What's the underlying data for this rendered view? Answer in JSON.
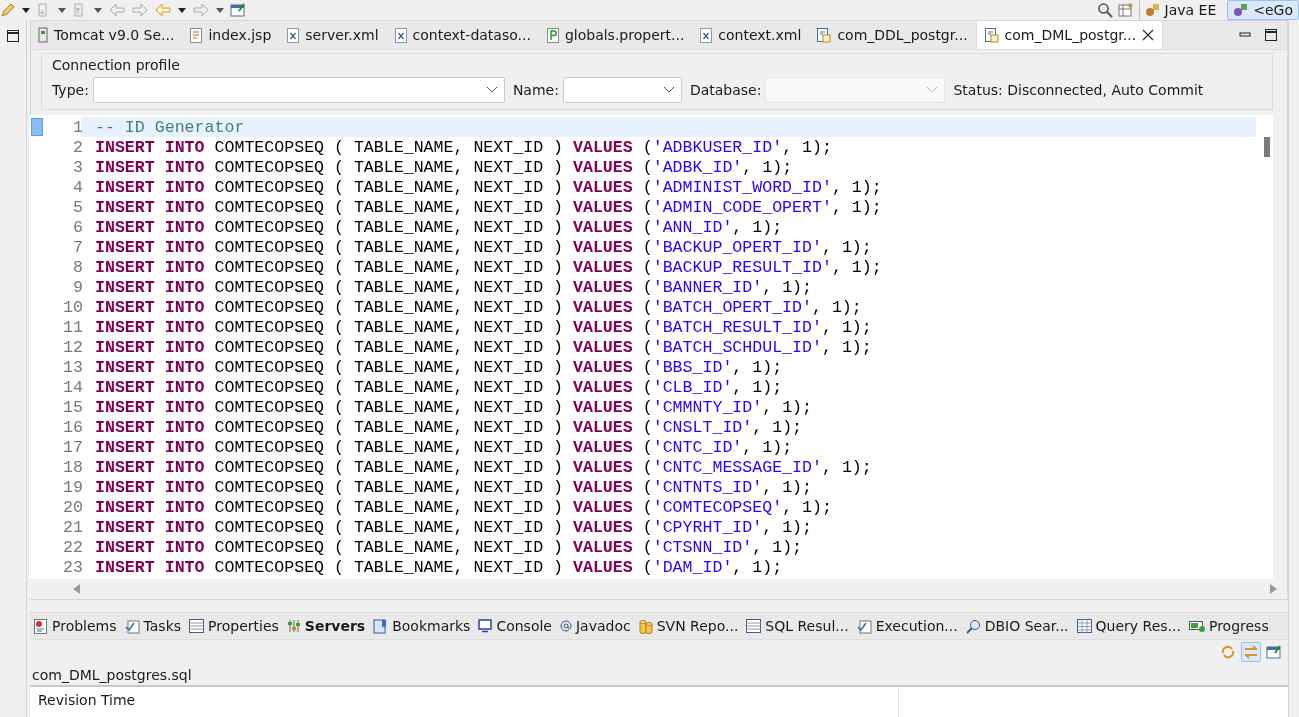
{
  "toolbar": {
    "perspectives": [
      {
        "label": "Java EE",
        "selected": false
      },
      {
        "label": "<eGo",
        "selected": true
      }
    ]
  },
  "editor_tabs": [
    {
      "label": "Tomcat v9.0 Se...",
      "selected": false
    },
    {
      "label": "index.jsp",
      "selected": false
    },
    {
      "label": "server.xml",
      "selected": false
    },
    {
      "label": "context-dataso...",
      "selected": false
    },
    {
      "label": "globals.propert...",
      "selected": false
    },
    {
      "label": "context.xml",
      "selected": false
    },
    {
      "label": "com_DDL_postgr...",
      "selected": false
    },
    {
      "label": "com_DML_postgr...",
      "selected": true
    }
  ],
  "connection_profile": {
    "title": "Connection profile",
    "type_label": "Type:",
    "name_label": "Name:",
    "database_label": "Database:",
    "status": "Status: Disconnected, Auto Commit"
  },
  "code_lines": [
    {
      "number": "1",
      "current": true,
      "tokens": [
        {
          "kind": "comment",
          "text": "-- ID Generator"
        }
      ]
    },
    {
      "number": "2",
      "current": false,
      "tokens": [
        {
          "kind": "keyword",
          "text": "INSERT INTO"
        },
        {
          "kind": "plain",
          "text": " COMTECOPSEQ ( TABLE_NAME, NEXT_ID ) "
        },
        {
          "kind": "keyword",
          "text": "VALUES"
        },
        {
          "kind": "plain",
          "text": " ("
        },
        {
          "kind": "string",
          "text": "'ADBKUSER_ID'"
        },
        {
          "kind": "plain",
          "text": ", 1);"
        }
      ]
    },
    {
      "number": "3",
      "current": false,
      "tokens": [
        {
          "kind": "keyword",
          "text": "INSERT INTO"
        },
        {
          "kind": "plain",
          "text": " COMTECOPSEQ ( TABLE_NAME, NEXT_ID ) "
        },
        {
          "kind": "keyword",
          "text": "VALUES"
        },
        {
          "kind": "plain",
          "text": " ("
        },
        {
          "kind": "string",
          "text": "'ADBK_ID'"
        },
        {
          "kind": "plain",
          "text": ", 1);"
        }
      ]
    },
    {
      "number": "4",
      "current": false,
      "tokens": [
        {
          "kind": "keyword",
          "text": "INSERT INTO"
        },
        {
          "kind": "plain",
          "text": " COMTECOPSEQ ( TABLE_NAME, NEXT_ID ) "
        },
        {
          "kind": "keyword",
          "text": "VALUES"
        },
        {
          "kind": "plain",
          "text": " ("
        },
        {
          "kind": "string",
          "text": "'ADMINIST_WORD_ID'"
        },
        {
          "kind": "plain",
          "text": ", 1);"
        }
      ]
    },
    {
      "number": "5",
      "current": false,
      "tokens": [
        {
          "kind": "keyword",
          "text": "INSERT INTO"
        },
        {
          "kind": "plain",
          "text": " COMTECOPSEQ ( TABLE_NAME, NEXT_ID ) "
        },
        {
          "kind": "keyword",
          "text": "VALUES"
        },
        {
          "kind": "plain",
          "text": " ("
        },
        {
          "kind": "string",
          "text": "'ADMIN_CODE_OPERT'"
        },
        {
          "kind": "plain",
          "text": ", 1);"
        }
      ]
    },
    {
      "number": "6",
      "current": false,
      "tokens": [
        {
          "kind": "keyword",
          "text": "INSERT INTO"
        },
        {
          "kind": "plain",
          "text": " COMTECOPSEQ ( TABLE_NAME, NEXT_ID ) "
        },
        {
          "kind": "keyword",
          "text": "VALUES"
        },
        {
          "kind": "plain",
          "text": " ("
        },
        {
          "kind": "string",
          "text": "'ANN_ID'"
        },
        {
          "kind": "plain",
          "text": ", 1);"
        }
      ]
    },
    {
      "number": "7",
      "current": false,
      "tokens": [
        {
          "kind": "keyword",
          "text": "INSERT INTO"
        },
        {
          "kind": "plain",
          "text": " COMTECOPSEQ ( TABLE_NAME, NEXT_ID ) "
        },
        {
          "kind": "keyword",
          "text": "VALUES"
        },
        {
          "kind": "plain",
          "text": " ("
        },
        {
          "kind": "string",
          "text": "'BACKUP_OPERT_ID'"
        },
        {
          "kind": "plain",
          "text": ", 1);"
        }
      ]
    },
    {
      "number": "8",
      "current": false,
      "tokens": [
        {
          "kind": "keyword",
          "text": "INSERT INTO"
        },
        {
          "kind": "plain",
          "text": " COMTECOPSEQ ( TABLE_NAME, NEXT_ID ) "
        },
        {
          "kind": "keyword",
          "text": "VALUES"
        },
        {
          "kind": "plain",
          "text": " ("
        },
        {
          "kind": "string",
          "text": "'BACKUP_RESULT_ID'"
        },
        {
          "kind": "plain",
          "text": ", 1);"
        }
      ]
    },
    {
      "number": "9",
      "current": false,
      "tokens": [
        {
          "kind": "keyword",
          "text": "INSERT INTO"
        },
        {
          "kind": "plain",
          "text": " COMTECOPSEQ ( TABLE_NAME, NEXT_ID ) "
        },
        {
          "kind": "keyword",
          "text": "VALUES"
        },
        {
          "kind": "plain",
          "text": " ("
        },
        {
          "kind": "string",
          "text": "'BANNER_ID'"
        },
        {
          "kind": "plain",
          "text": ", 1);"
        }
      ]
    },
    {
      "number": "10",
      "current": false,
      "tokens": [
        {
          "kind": "keyword",
          "text": "INSERT INTO"
        },
        {
          "kind": "plain",
          "text": " COMTECOPSEQ ( TABLE_NAME, NEXT_ID ) "
        },
        {
          "kind": "keyword",
          "text": "VALUES"
        },
        {
          "kind": "plain",
          "text": " ("
        },
        {
          "kind": "string",
          "text": "'BATCH_OPERT_ID'"
        },
        {
          "kind": "plain",
          "text": ", 1);"
        }
      ]
    },
    {
      "number": "11",
      "current": false,
      "tokens": [
        {
          "kind": "keyword",
          "text": "INSERT INTO"
        },
        {
          "kind": "plain",
          "text": " COMTECOPSEQ ( TABLE_NAME, NEXT_ID ) "
        },
        {
          "kind": "keyword",
          "text": "VALUES"
        },
        {
          "kind": "plain",
          "text": " ("
        },
        {
          "kind": "string",
          "text": "'BATCH_RESULT_ID'"
        },
        {
          "kind": "plain",
          "text": ", 1);"
        }
      ]
    },
    {
      "number": "12",
      "current": false,
      "tokens": [
        {
          "kind": "keyword",
          "text": "INSERT INTO"
        },
        {
          "kind": "plain",
          "text": " COMTECOPSEQ ( TABLE_NAME, NEXT_ID ) "
        },
        {
          "kind": "keyword",
          "text": "VALUES"
        },
        {
          "kind": "plain",
          "text": " ("
        },
        {
          "kind": "string",
          "text": "'BATCH_SCHDUL_ID'"
        },
        {
          "kind": "plain",
          "text": ", 1);"
        }
      ]
    },
    {
      "number": "13",
      "current": false,
      "tokens": [
        {
          "kind": "keyword",
          "text": "INSERT INTO"
        },
        {
          "kind": "plain",
          "text": " COMTECOPSEQ ( TABLE_NAME, NEXT_ID ) "
        },
        {
          "kind": "keyword",
          "text": "VALUES"
        },
        {
          "kind": "plain",
          "text": " ("
        },
        {
          "kind": "string",
          "text": "'BBS_ID'"
        },
        {
          "kind": "plain",
          "text": ", 1);"
        }
      ]
    },
    {
      "number": "14",
      "current": false,
      "tokens": [
        {
          "kind": "keyword",
          "text": "INSERT INTO"
        },
        {
          "kind": "plain",
          "text": " COMTECOPSEQ ( TABLE_NAME, NEXT_ID ) "
        },
        {
          "kind": "keyword",
          "text": "VALUES"
        },
        {
          "kind": "plain",
          "text": " ("
        },
        {
          "kind": "string",
          "text": "'CLB_ID'"
        },
        {
          "kind": "plain",
          "text": ", 1);"
        }
      ]
    },
    {
      "number": "15",
      "current": false,
      "tokens": [
        {
          "kind": "keyword",
          "text": "INSERT INTO"
        },
        {
          "kind": "plain",
          "text": " COMTECOPSEQ ( TABLE_NAME, NEXT_ID ) "
        },
        {
          "kind": "keyword",
          "text": "VALUES"
        },
        {
          "kind": "plain",
          "text": " ("
        },
        {
          "kind": "string",
          "text": "'CMMNTY_ID'"
        },
        {
          "kind": "plain",
          "text": ", 1);"
        }
      ]
    },
    {
      "number": "16",
      "current": false,
      "tokens": [
        {
          "kind": "keyword",
          "text": "INSERT INTO"
        },
        {
          "kind": "plain",
          "text": " COMTECOPSEQ ( TABLE_NAME, NEXT_ID ) "
        },
        {
          "kind": "keyword",
          "text": "VALUES"
        },
        {
          "kind": "plain",
          "text": " ("
        },
        {
          "kind": "string",
          "text": "'CNSLT_ID'"
        },
        {
          "kind": "plain",
          "text": ", 1);"
        }
      ]
    },
    {
      "number": "17",
      "current": false,
      "tokens": [
        {
          "kind": "keyword",
          "text": "INSERT INTO"
        },
        {
          "kind": "plain",
          "text": " COMTECOPSEQ ( TABLE_NAME, NEXT_ID ) "
        },
        {
          "kind": "keyword",
          "text": "VALUES"
        },
        {
          "kind": "plain",
          "text": " ("
        },
        {
          "kind": "string",
          "text": "'CNTC_ID'"
        },
        {
          "kind": "plain",
          "text": ", 1);"
        }
      ]
    },
    {
      "number": "18",
      "current": false,
      "tokens": [
        {
          "kind": "keyword",
          "text": "INSERT INTO"
        },
        {
          "kind": "plain",
          "text": " COMTECOPSEQ ( TABLE_NAME, NEXT_ID ) "
        },
        {
          "kind": "keyword",
          "text": "VALUES"
        },
        {
          "kind": "plain",
          "text": " ("
        },
        {
          "kind": "string",
          "text": "'CNTC_MESSAGE_ID'"
        },
        {
          "kind": "plain",
          "text": ", 1);"
        }
      ]
    },
    {
      "number": "19",
      "current": false,
      "tokens": [
        {
          "kind": "keyword",
          "text": "INSERT INTO"
        },
        {
          "kind": "plain",
          "text": " COMTECOPSEQ ( TABLE_NAME, NEXT_ID ) "
        },
        {
          "kind": "keyword",
          "text": "VALUES"
        },
        {
          "kind": "plain",
          "text": " ("
        },
        {
          "kind": "string",
          "text": "'CNTNTS_ID'"
        },
        {
          "kind": "plain",
          "text": ", 1);"
        }
      ]
    },
    {
      "number": "20",
      "current": false,
      "tokens": [
        {
          "kind": "keyword",
          "text": "INSERT INTO"
        },
        {
          "kind": "plain",
          "text": " COMTECOPSEQ ( TABLE_NAME, NEXT_ID ) "
        },
        {
          "kind": "keyword",
          "text": "VALUES"
        },
        {
          "kind": "plain",
          "text": " ("
        },
        {
          "kind": "string",
          "text": "'COMTECOPSEQ'"
        },
        {
          "kind": "plain",
          "text": ", 1);"
        }
      ]
    },
    {
      "number": "21",
      "current": false,
      "tokens": [
        {
          "kind": "keyword",
          "text": "INSERT INTO"
        },
        {
          "kind": "plain",
          "text": " COMTECOPSEQ ( TABLE_NAME, NEXT_ID ) "
        },
        {
          "kind": "keyword",
          "text": "VALUES"
        },
        {
          "kind": "plain",
          "text": " ("
        },
        {
          "kind": "string",
          "text": "'CPYRHT_ID'"
        },
        {
          "kind": "plain",
          "text": ", 1);"
        }
      ]
    },
    {
      "number": "22",
      "current": false,
      "tokens": [
        {
          "kind": "keyword",
          "text": "INSERT INTO"
        },
        {
          "kind": "plain",
          "text": " COMTECOPSEQ ( TABLE_NAME, NEXT_ID ) "
        },
        {
          "kind": "keyword",
          "text": "VALUES"
        },
        {
          "kind": "plain",
          "text": " ("
        },
        {
          "kind": "string",
          "text": "'CTSNN_ID'"
        },
        {
          "kind": "plain",
          "text": ", 1);"
        }
      ]
    },
    {
      "number": "23",
      "current": false,
      "tokens": [
        {
          "kind": "keyword",
          "text": "INSERT INTO"
        },
        {
          "kind": "plain",
          "text": " COMTECOPSEQ ( TABLE_NAME, NEXT_ID ) "
        },
        {
          "kind": "keyword",
          "text": "VALUES"
        },
        {
          "kind": "plain",
          "text": " ("
        },
        {
          "kind": "string",
          "text": "'DAM_ID'"
        },
        {
          "kind": "plain",
          "text": ", 1);"
        }
      ]
    }
  ],
  "bottom_tabs": [
    {
      "label": "Problems",
      "selected": false
    },
    {
      "label": "Tasks",
      "selected": false
    },
    {
      "label": "Properties",
      "selected": false
    },
    {
      "label": "Servers",
      "selected": true
    },
    {
      "label": "Bookmarks",
      "selected": false
    },
    {
      "label": "Console",
      "selected": false
    },
    {
      "label": "Javadoc",
      "selected": false
    },
    {
      "label": "SVN Repo...",
      "selected": false
    },
    {
      "label": "SQL Resul...",
      "selected": false
    },
    {
      "label": "Execution...",
      "selected": false
    },
    {
      "label": "DBIO Sear...",
      "selected": false
    },
    {
      "label": "Query Res...",
      "selected": false
    },
    {
      "label": "Progress",
      "selected": false
    }
  ],
  "history": {
    "file_name": "com_DML_postgres.sql",
    "columns": [
      "Revision Time"
    ]
  }
}
